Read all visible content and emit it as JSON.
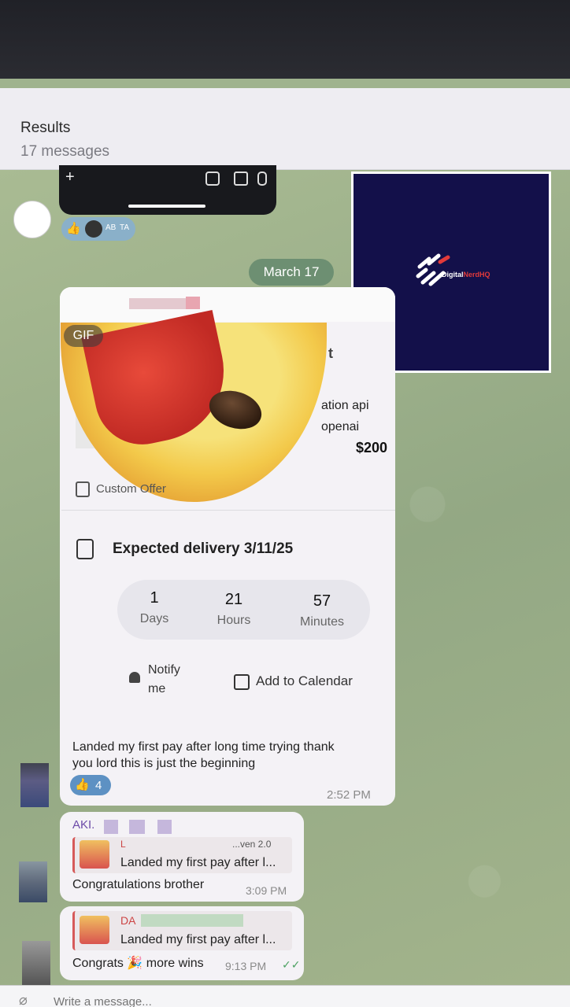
{
  "results": {
    "title": "Results",
    "count": "17 messages"
  },
  "date_pill": "March 17",
  "logo": {
    "name_prefix": "Digital",
    "name_suffix": "NerdHQ"
  },
  "reactions": {
    "initials_1": "AB",
    "initials_2": "TA"
  },
  "gif_tag": "GIF",
  "offer": {
    "title_fragment": "t",
    "line1": "ation api",
    "line2": "openai",
    "price": "$200",
    "label": "Custom Offer"
  },
  "delivery": {
    "label": "Expected delivery 3/11/25",
    "days_value": "1",
    "days_unit": "Days",
    "hours_value": "21",
    "hours_unit": "Hours",
    "minutes_value": "57",
    "minutes_unit": "Minutes",
    "notify_line1": "Notify",
    "notify_line2": "me",
    "add_calendar": "Add to Calendar"
  },
  "main_message": {
    "text_line1": "Landed my first pay after long time trying thank",
    "text_line2": "you lord this is just the beginning",
    "like_count": "4",
    "time": "2:52 PM"
  },
  "reply1": {
    "sender_fragment": "AKI.",
    "quote_title_fragment": "L",
    "quote_right_fragment": "...ven 2.0",
    "quote_text": "Landed my first pay after l...",
    "text": "Congratulations brother",
    "time": "3:09 PM"
  },
  "reply2": {
    "quote_title_fragment": "DA",
    "quote_text": "Landed my first pay after l...",
    "text": "Congrats 🎉 more wins",
    "time": "9:13 PM",
    "check": "✓✓"
  },
  "composer": {
    "placeholder": "Write a message..."
  }
}
